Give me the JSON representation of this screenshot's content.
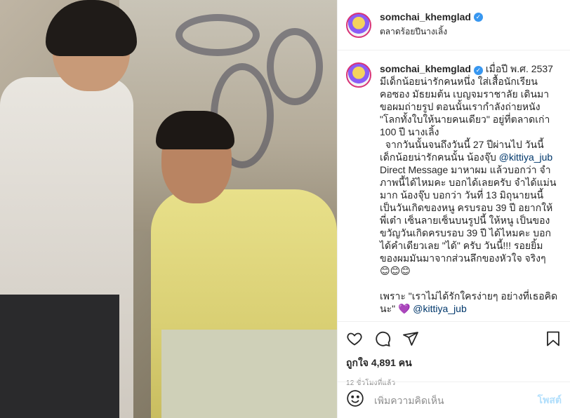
{
  "post": {
    "username": "somchai_khemglad",
    "verified": true,
    "location": "ตลาดร้อยปีนางเลิ้ง"
  },
  "caption": {
    "username": "somchai_khemglad",
    "text_part1": " เมื่อปี พ.ศ. 2537\nมีเด็กน้อยน่ารักคนหนึ่ง ใส่เสื้อนักเรียน\nคอซอง มัธยมต้น เบญจมราชาลัย เดินมา\nขอผมถ่ายรูป ตอนนั้นเรากำลังถ่ายหนัง\n\"โลกทั้งใบให้นายคนเดียว\" อยู่ที่ตลาดเก่า\n100 ปี นางเลิ้ง\n  จากวันนั้นจนถึงวันนี้ 27 ปีผ่านไป วันนี้\nเด็กน้อยน่ารักคนนั้น น้องจุ๊บ ",
    "mention1": "@kittiya_jub",
    "text_part2": "\nDirect Message มาหาผม แล้วบอกว่า จำ\nภาพนี้ได้ไหมคะ บอกได้เลยครับ จำได้แม่น\nมาก น้องจุ๊บ บอกว่า วันที่ 13 มิถุนายนนี้\nเป็นวันเกิดของหนู ครบรอบ 39 ปี อยากให้\nพี่เต๋า เซ็นลายเซ็นบนรูปนี้ ให้หนู เป็นของ\nขวัญวันเกิดครบรอบ 39 ปี ได้ไหมคะ บอก\nได้คำเดียวเลย \"ได้\" ครับ วันนี้!!! รอยยิ้ม\nของผมมันมาจากส่วนลึกของหัวใจ จริงๆ\n😊😊😊\n\nเพราะ \"เราไม่ได้รักใครง่ายๆ อย่างที่เธอคิด\nนะ\" 💜 ",
    "mention2": "@kittiya_jub"
  },
  "engagement": {
    "likes": "ถูกใจ 4,891 คน",
    "timestamp": "12 ชั่วโมงที่แล้ว"
  },
  "comment": {
    "placeholder": "เพิ่มความคิดเห็น",
    "post_label": "โพสต์"
  },
  "icons": [
    "heart-icon",
    "comment-icon",
    "share-icon",
    "bookmark-icon",
    "emoji-icon"
  ],
  "colors": {
    "verified": "#3897f0",
    "mention": "#00376b",
    "post_button": "#b2dffc",
    "avatar_ring": "#d83377"
  }
}
